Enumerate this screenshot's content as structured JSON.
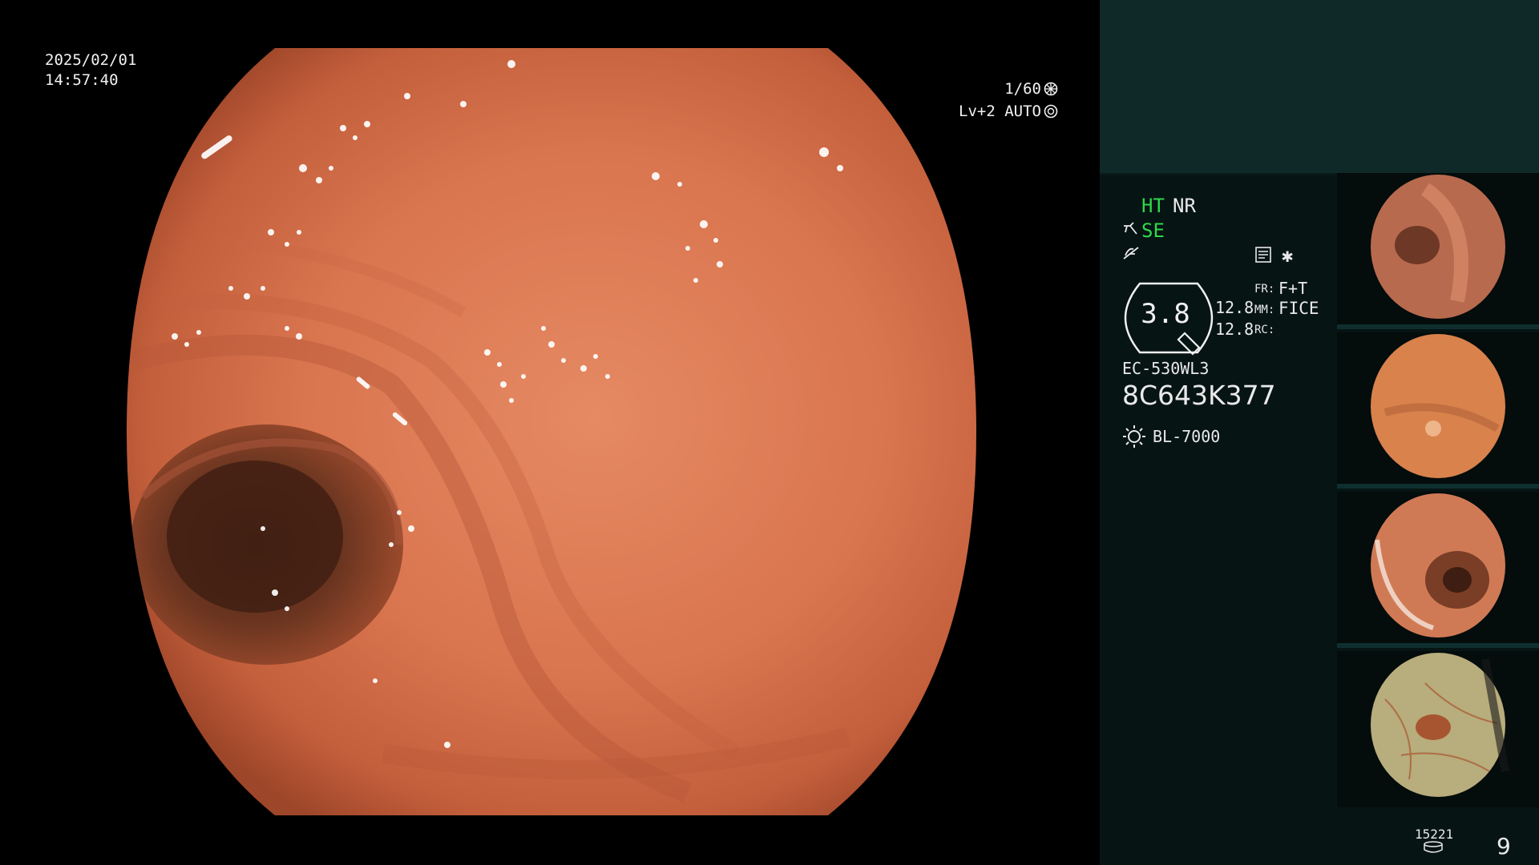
{
  "overlay": {
    "date": "2025/02/01",
    "time": "14:57:40",
    "shutter": "1/60",
    "shutter_icon": "iris-icon",
    "level": "Lv+2",
    "mode": "AUTO",
    "mode_icon": "aperture-icon"
  },
  "panel": {
    "ht_label": "HT",
    "nr_label": "NR",
    "se_label": "SE",
    "enhancement_value": "3.8",
    "value_a": "12.8",
    "value_b": "12.8",
    "fr_key": "FR:",
    "fr_value": "F+T",
    "mm_key": "MM:",
    "mm_value": "FICE",
    "rc_key": "RC:",
    "scope_model": "EC-530WL3",
    "scope_serial": "8C643K377",
    "light_source": "BL-7000",
    "storage_count": "15221",
    "page_number": "9"
  },
  "thumbnails": [
    {
      "name": "capture-1",
      "tint": "#b86a4e"
    },
    {
      "name": "capture-2",
      "tint": "#d9824c"
    },
    {
      "name": "capture-3",
      "tint": "#d07a55"
    },
    {
      "name": "capture-4",
      "tint": "#b8ad7c"
    }
  ],
  "colors": {
    "panel_bg": "#071414",
    "header_bg": "#0f2929",
    "status_green": "#2fd84b",
    "mucosa": "#d9754f"
  }
}
